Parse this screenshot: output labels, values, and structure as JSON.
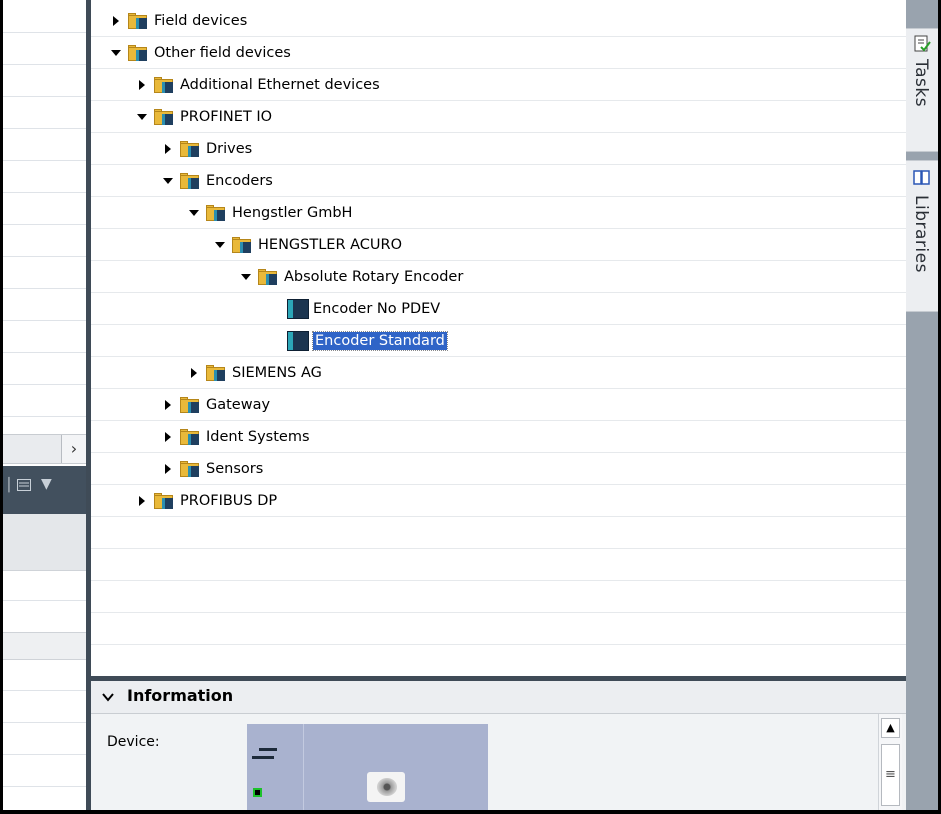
{
  "tree": [
    {
      "label": "Field devices",
      "state": "collapsed",
      "icon": "folder-device-icon"
    },
    {
      "label": "Other field devices",
      "state": "expanded",
      "icon": "folder-device-icon"
    },
    {
      "label": "Additional Ethernet devices",
      "state": "collapsed",
      "icon": "folder-device-icon"
    },
    {
      "label": "PROFINET IO",
      "state": "expanded",
      "icon": "folder-device-icon"
    },
    {
      "label": "Drives",
      "state": "collapsed",
      "icon": "folder-device-icon"
    },
    {
      "label": "Encoders",
      "state": "expanded",
      "icon": "folder-device-icon"
    },
    {
      "label": "Hengstler GmbH",
      "state": "expanded",
      "icon": "folder-device-icon"
    },
    {
      "label": "HENGSTLER ACURO",
      "state": "expanded",
      "icon": "folder-device-icon"
    },
    {
      "label": "Absolute Rotary Encoder",
      "state": "expanded",
      "icon": "folder-device-icon"
    },
    {
      "label": "Encoder No PDEV",
      "state": "leaf",
      "icon": "device-module-icon"
    },
    {
      "label": "Encoder Standard",
      "state": "leaf",
      "icon": "device-module-icon",
      "selected": true
    },
    {
      "label": "SIEMENS AG",
      "state": "collapsed",
      "icon": "folder-device-icon"
    },
    {
      "label": "Gateway",
      "state": "collapsed",
      "icon": "folder-device-icon"
    },
    {
      "label": "Ident Systems",
      "state": "collapsed",
      "icon": "folder-device-icon"
    },
    {
      "label": "Sensors",
      "state": "collapsed",
      "icon": "folder-device-icon"
    },
    {
      "label": "PROFIBUS DP",
      "state": "collapsed",
      "icon": "folder-device-icon"
    }
  ],
  "info": {
    "title": "Information",
    "device_label": "Device:",
    "collapse_icon": "chevron-down-icon"
  },
  "right_tabs": [
    {
      "label": "Tasks",
      "icon": "tasks-icon"
    },
    {
      "label": "Libraries",
      "icon": "libraries-icon"
    }
  ],
  "colors": {
    "selection": "#2f64c7",
    "folder": "#e9b93a",
    "splitter": "#3f4b57",
    "device_image_bg": "#a9b2cf"
  }
}
